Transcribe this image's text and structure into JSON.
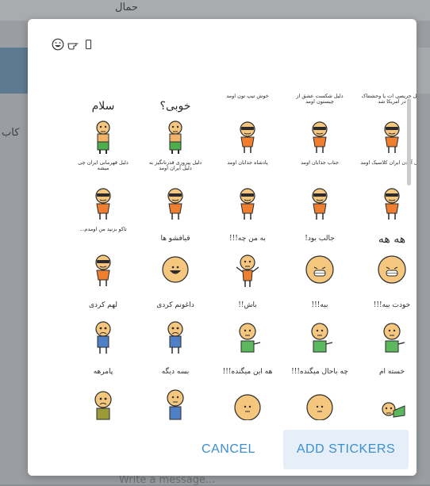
{
  "background": {
    "top_text": "حمال",
    "left_text": "کاب",
    "input_placeholder": "Write a message..."
  },
  "dialog": {
    "emoji_icons": [
      "grinning-face-icon",
      "pointing-hand-icon",
      "placeholder-box-icon"
    ],
    "stickers": [
      {
        "caption": "سلام",
        "size": "big",
        "figure": "standing-green"
      },
      {
        "caption": "خوبی؟",
        "size": "big",
        "figure": "standing-green"
      },
      {
        "caption": "خوش تیپ تون اومد",
        "size": "sm",
        "figure": "shades-orange"
      },
      {
        "caption": "دلیل شکست عشق از چیستون اومد",
        "size": "sm",
        "figure": "shades-orange"
      },
      {
        "caption": "دلیل حریصی ات یا وحشتناک در آمریکا شد",
        "size": "sm",
        "figure": "shades-orange"
      },
      {
        "caption": "دلیل قهرمانی ایران چی میشه",
        "size": "sm",
        "figure": "shades-orange"
      },
      {
        "caption": "دلیل پیروزی قدرتانگیز به دلیل ایران اومد",
        "size": "sm",
        "figure": "shades-orange"
      },
      {
        "caption": "پادشاه جذابان اومد",
        "size": "sm",
        "figure": "shades-orange"
      },
      {
        "caption": "جناب جذابان اومد",
        "size": "sm",
        "figure": "shades-orange"
      },
      {
        "caption": "دلیل آمدن ایران کلاسیک اومد",
        "size": "sm",
        "figure": "shades-orange"
      },
      {
        "caption": "تاکو بزنید من اومدم...",
        "size": "sm",
        "figure": "shades-orange"
      },
      {
        "caption": "قیافشو ها",
        "size": "med",
        "figure": "grin-face"
      },
      {
        "caption": "به من چه!!!",
        "size": "med",
        "figure": "shrug-orange"
      },
      {
        "caption": "جالب بود!",
        "size": "med",
        "figure": "laugh-face"
      },
      {
        "caption": "هه هه",
        "size": "big",
        "figure": "laugh-face"
      },
      {
        "caption": "لهم کردی",
        "size": "med",
        "figure": "sad-blue"
      },
      {
        "caption": "داغونم کردی",
        "size": "med",
        "figure": "sad-blue"
      },
      {
        "caption": "باش!!",
        "size": "med",
        "figure": "point-green"
      },
      {
        "caption": "بیه!!!",
        "size": "med",
        "figure": "point-green"
      },
      {
        "caption": "خودت بیه!!!",
        "size": "med",
        "figure": "point-green"
      },
      {
        "caption": "پامرهه",
        "size": "med",
        "figure": "olive-head"
      },
      {
        "caption": "بسه دیگه",
        "size": "med",
        "figure": "blue-head"
      },
      {
        "caption": "هه این میگنده!!!",
        "size": "med",
        "figure": "plain-face"
      },
      {
        "caption": "چه باحال میگنده!!!",
        "size": "med",
        "figure": "plain-face"
      },
      {
        "caption": "خسته ام",
        "size": "med",
        "figure": "green-lying"
      }
    ],
    "cancel_label": "CANCEL",
    "add_label": "ADD STICKERS"
  }
}
